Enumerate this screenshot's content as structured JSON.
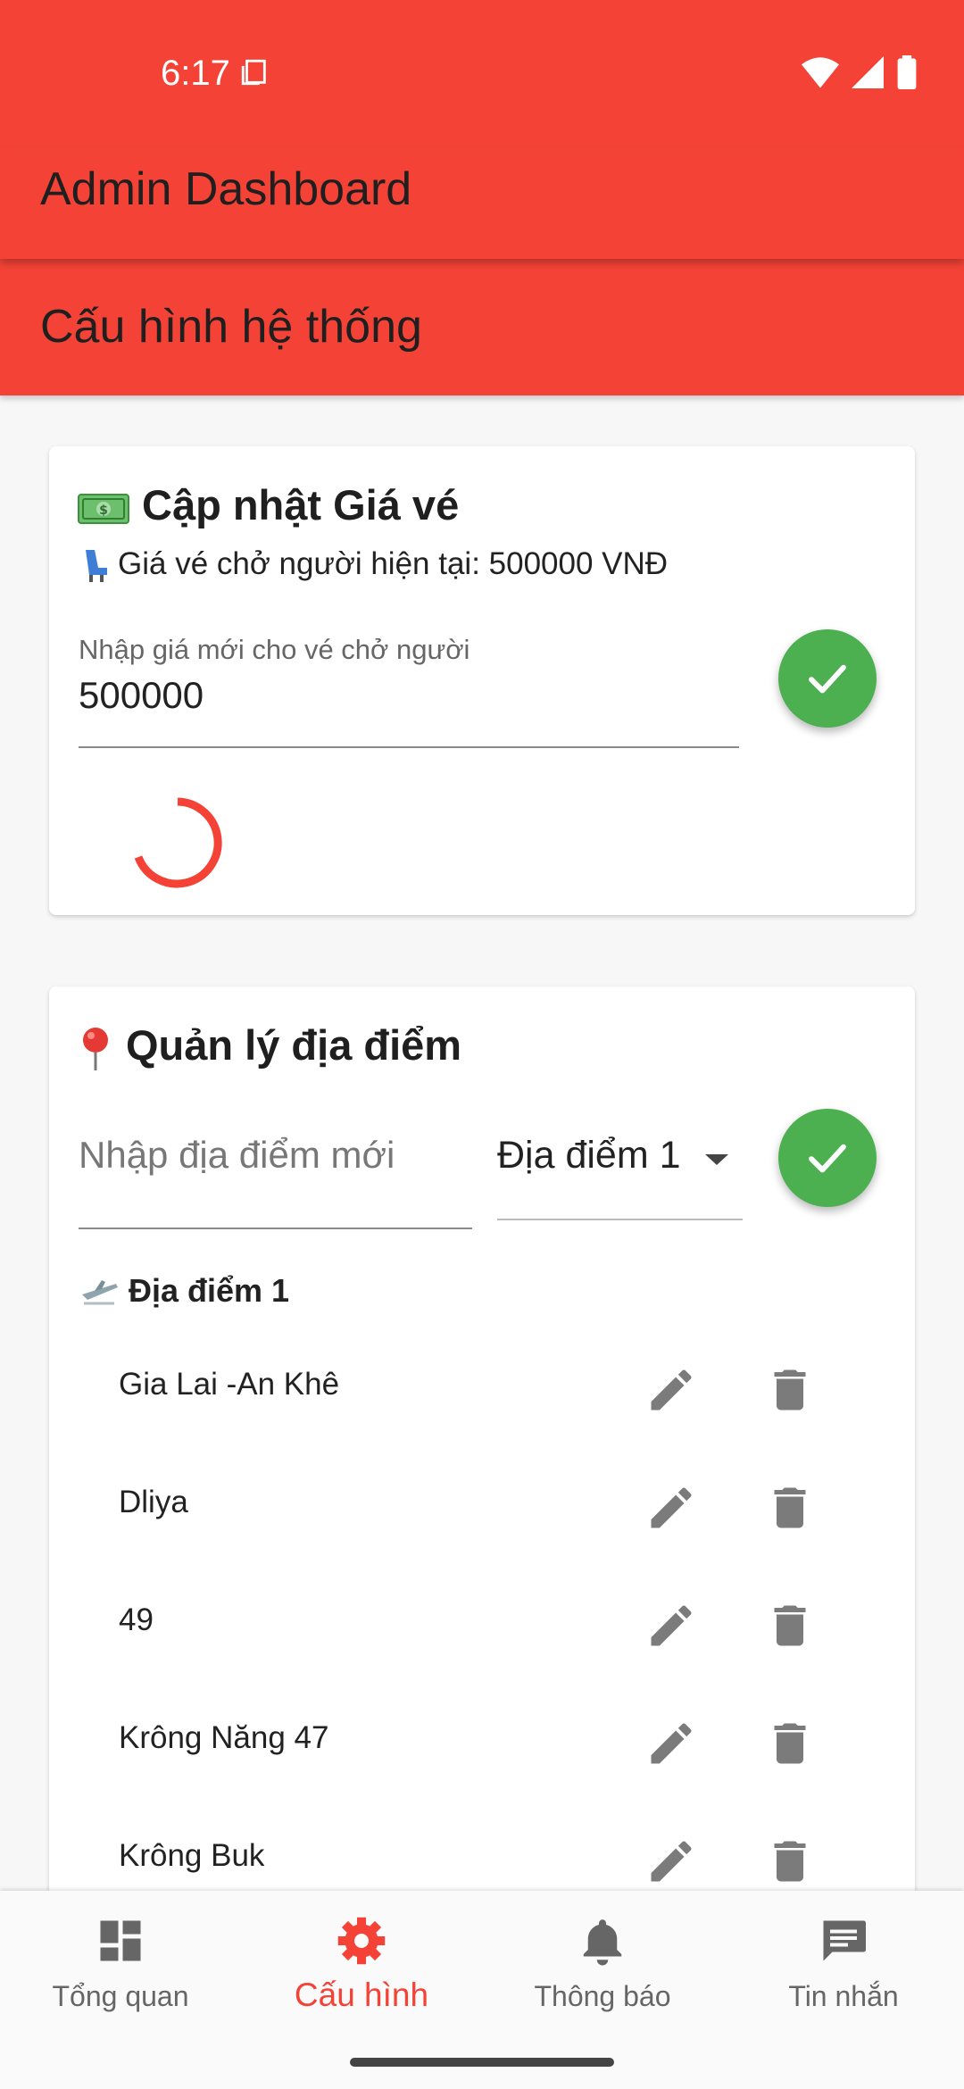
{
  "status": {
    "time": "6:17"
  },
  "app": {
    "title": "Admin Dashboard",
    "subtitle": "Cấu hình hệ thống"
  },
  "ticket_card": {
    "icon": "money-emoji",
    "title": "Cập nhật Giá vé",
    "current_price": "Giá vé chở người hiện tại: 500000 VNĐ",
    "input_label": "Nhập giá mới cho vé chở người",
    "input_value": "500000",
    "submit_icon": "check-icon"
  },
  "location_card": {
    "icon": "pin-emoji",
    "title": "Quản lý địa điểm",
    "input_placeholder": "Nhập địa điểm mới",
    "dropdown_value": "Địa điểm 1",
    "group_title": "Địa điểm 1",
    "locations": [
      {
        "name": "Gia Lai -An Khê"
      },
      {
        "name": "Dliya"
      },
      {
        "name": "49"
      },
      {
        "name": "Krông Năng 47"
      },
      {
        "name": "Krông Buk"
      }
    ]
  },
  "bottom_nav": {
    "items": [
      {
        "label": "Tổng quan",
        "icon": "dashboard-icon"
      },
      {
        "label": "Cấu hình",
        "icon": "gear-icon",
        "active": true
      },
      {
        "label": "Thông báo",
        "icon": "bell-icon"
      },
      {
        "label": "Tin nhắn",
        "icon": "message-icon"
      }
    ]
  },
  "colors": {
    "primary": "#f44336",
    "success": "#4caf50",
    "icon_gray": "#7b7b7b"
  }
}
